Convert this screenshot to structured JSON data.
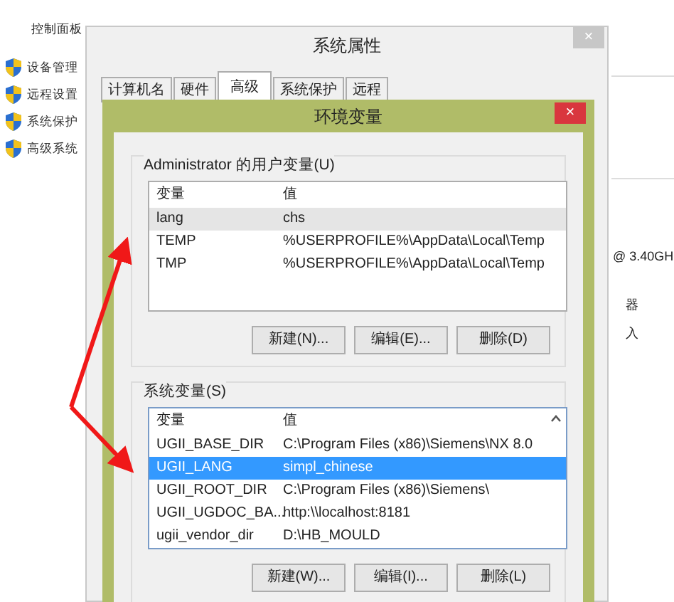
{
  "background_page": {
    "breadcrumb": "控制面板",
    "links": [
      "设备管理",
      "远程设置",
      "系统保护",
      "高级系统"
    ],
    "right_texts": [
      "@ 3.40GH",
      "器",
      "入"
    ]
  },
  "system_properties": {
    "title": "系统属性",
    "close": "×",
    "tabs": [
      {
        "label": "计算机名",
        "selected": false
      },
      {
        "label": "硬件",
        "selected": false
      },
      {
        "label": "高级",
        "selected": true
      },
      {
        "label": "系统保护",
        "selected": false
      },
      {
        "label": "远程",
        "selected": false
      }
    ]
  },
  "environment_variables": {
    "title": "环境变量",
    "close": "×",
    "user_variables": {
      "label": "Administrator 的用户变量(U)",
      "focused": false,
      "scrollbar": false,
      "columns": [
        "变量",
        "值"
      ],
      "rows": [
        {
          "name": "lang",
          "value": "chs",
          "selected": true
        },
        {
          "name": "TEMP",
          "value": "%USERPROFILE%\\AppData\\Local\\Temp",
          "selected": false
        },
        {
          "name": "TMP",
          "value": "%USERPROFILE%\\AppData\\Local\\Temp",
          "selected": false
        }
      ],
      "buttons": [
        "新建(N)...",
        "编辑(E)...",
        "删除(D)"
      ]
    },
    "system_variables": {
      "label": "系统变量(S)",
      "focused": true,
      "scrollbar": true,
      "columns": [
        "变量",
        "值"
      ],
      "rows": [
        {
          "name": "UGII_BASE_DIR",
          "value": "C:\\Program Files (x86)\\Siemens\\NX 8.0",
          "selected": false
        },
        {
          "name": "UGII_LANG",
          "value": "simpl_chinese",
          "selected": true
        },
        {
          "name": "UGII_ROOT_DIR",
          "value": "C:\\Program Files (x86)\\Siemens\\",
          "selected": false
        },
        {
          "name": "UGII_UGDOC_BA...",
          "value": "http:\\\\localhost:8181",
          "selected": false
        },
        {
          "name": "ugii_vendor_dir",
          "value": "D:\\HB_MOULD",
          "selected": false
        }
      ],
      "buttons": [
        "新建(W)...",
        "编辑(I)...",
        "删除(L)"
      ]
    }
  },
  "annotation": {
    "kind": "arrows"
  }
}
